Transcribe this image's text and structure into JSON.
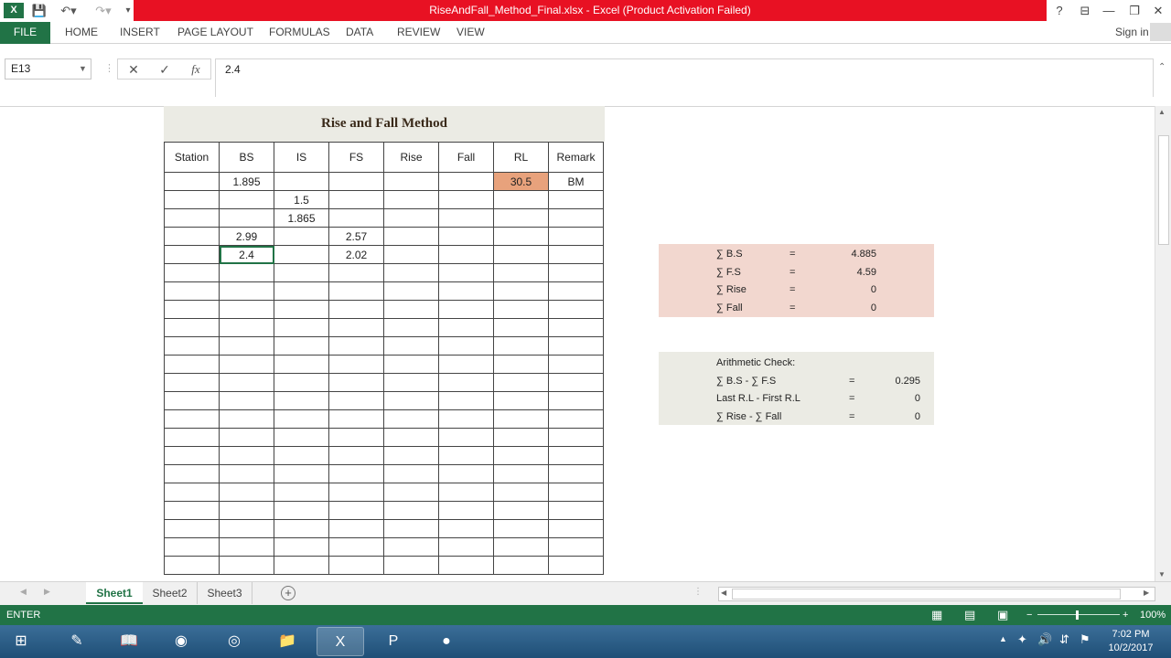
{
  "window": {
    "title": "RiseAndFall_Method_Final.xlsx - Excel (Product Activation Failed)",
    "sign_in": "Sign in",
    "help": "?",
    "controls": {
      "restore_ribbon": "⊟",
      "minimize": "—",
      "maximize": "❐",
      "close": "✕"
    }
  },
  "ribbon": {
    "tabs": [
      "FILE",
      "HOME",
      "INSERT",
      "PAGE LAYOUT",
      "FORMULAS",
      "DATA",
      "REVIEW",
      "VIEW"
    ]
  },
  "formula_bar": {
    "name_box": "E13",
    "value": "2.4",
    "cancel": "✕",
    "enter": "✓",
    "fx": "fx"
  },
  "survey": {
    "title": "Rise and Fall Method",
    "headers": [
      "Station",
      "BS",
      "IS",
      "FS",
      "Rise",
      "Fall",
      "RL",
      "Remark"
    ],
    "rows": [
      [
        "",
        "1.895",
        "",
        "",
        "",
        "",
        "30.5",
        "BM"
      ],
      [
        "",
        "",
        "1.5",
        "",
        "",
        "",
        "",
        ""
      ],
      [
        "",
        "",
        "1.865",
        "",
        "",
        "",
        "",
        ""
      ],
      [
        "",
        "2.99",
        "",
        "2.57",
        "",
        "",
        "",
        ""
      ],
      [
        "",
        "2.4",
        "",
        "2.02",
        "",
        "",
        "",
        ""
      ]
    ],
    "empty_rows": 17
  },
  "summary": {
    "rows": [
      {
        "label": "∑ B.S",
        "eq": "=",
        "value": "4.885"
      },
      {
        "label": "∑ F.S",
        "eq": "=",
        "value": "4.59"
      },
      {
        "label": "∑ Rise",
        "eq": "=",
        "value": "0"
      },
      {
        "label": "∑ Fall",
        "eq": "=",
        "value": "0"
      }
    ]
  },
  "arith_check": {
    "heading": "Arithmetic Check:",
    "rows": [
      {
        "label": "∑ B.S - ∑ F.S",
        "eq": "=",
        "value": "0.295"
      },
      {
        "label": "Last  R.L - First R.L",
        "eq": "=",
        "value": "0"
      },
      {
        "label": "∑ Rise - ∑ Fall",
        "eq": "=",
        "value": "0"
      }
    ]
  },
  "sheets": [
    "Sheet1",
    "Sheet2",
    "Sheet3"
  ],
  "active_sheet": "Sheet1",
  "status": {
    "mode": "ENTER",
    "zoom": "100%"
  },
  "clock": {
    "time": "7:02 PM",
    "date": "10/2/2017"
  },
  "colors": {
    "excel_green": "#217346",
    "title_red": "#e81123",
    "rl_highlight": "#e8a27c",
    "summary_bg": "#f2d7cf",
    "check_bg": "#ebebe4"
  }
}
